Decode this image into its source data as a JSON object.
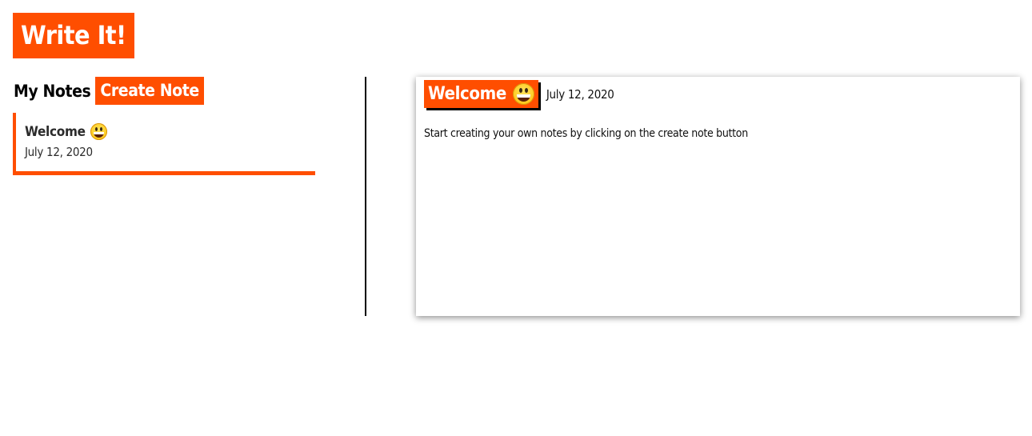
{
  "app": {
    "title": "Write It!"
  },
  "colors": {
    "accent": "#ff4e00",
    "text": "#111111",
    "divider": "#000000"
  },
  "sidebar": {
    "heading": "My Notes",
    "create_button_label": "Create Note",
    "notes": [
      {
        "title": "Welcome",
        "icon": "grinning-face-emoji",
        "date": "July 12, 2020"
      }
    ]
  },
  "note_view": {
    "title": "Welcome",
    "icon": "grinning-face-emoji",
    "date": "July 12, 2020",
    "body": "Start creating your own notes by clicking on the create note button"
  }
}
